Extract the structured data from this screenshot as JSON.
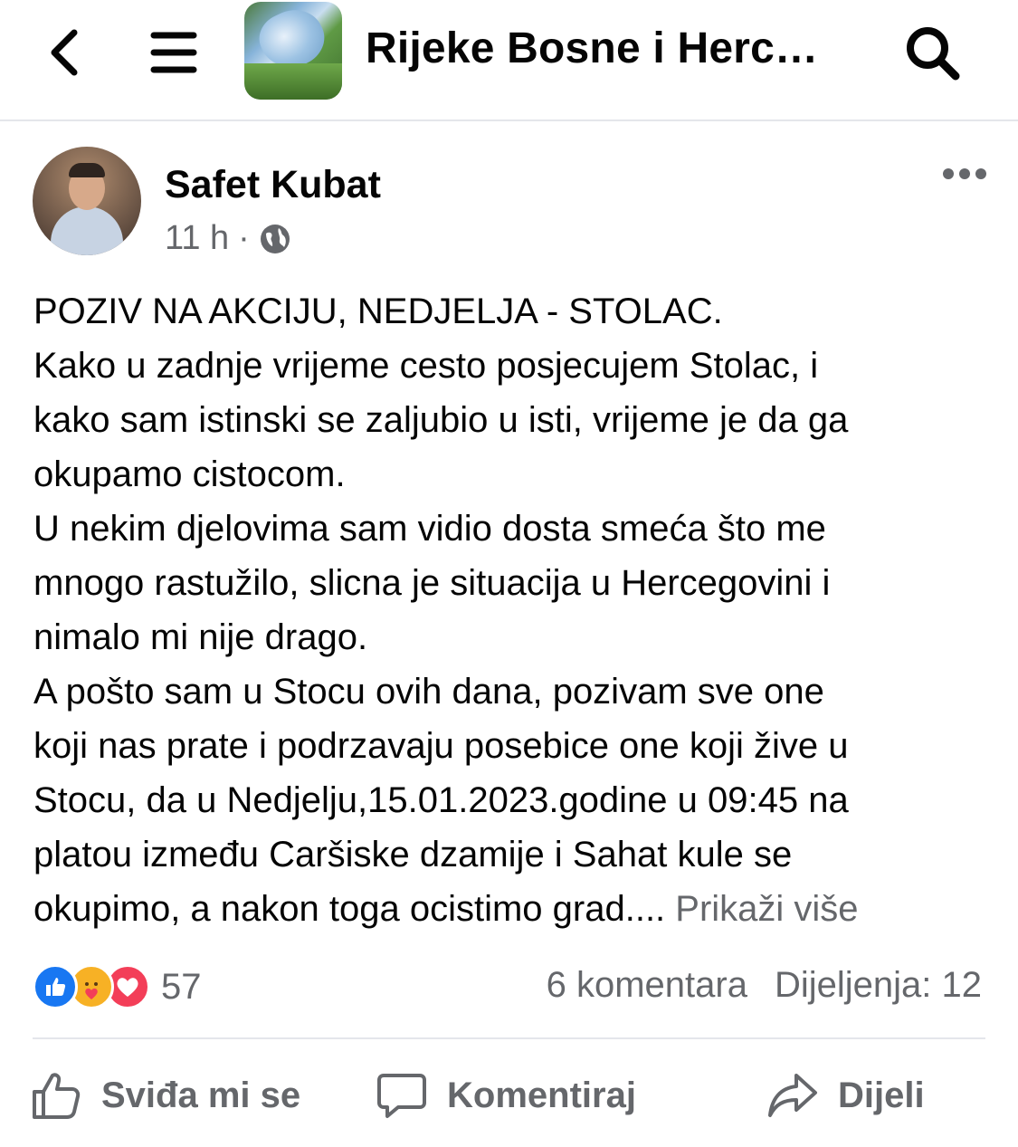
{
  "header": {
    "group_title": "Rijeke Bosne i Herc…"
  },
  "post": {
    "author": "Safet Kubat",
    "time": "11 h",
    "separator": "·",
    "body_lines": [
      "POZIV NA AKCIJU, NEDJELJA - STOLAC.",
      "Kako u zadnje vrijeme cesto posjecujem Stolac, i",
      "kako sam istinski se zaljubio u isti, vrijeme je da ga",
      "okupamo cistocom.",
      "U nekim djelovima sam vidio dosta smeća što me",
      "mnogo rastužilo, slicna je situacija u Hercegovini i",
      "nimalo mi nije drago.",
      "A pošto sam u Stocu ovih dana, pozivam sve one",
      "koji nas prate i podrzavaju posebice one koji žive u",
      "Stocu, da u Nedjelju,15.01.2023.godine u 09:45 na",
      "platou između Caršiske  dzamije i Sahat kule se"
    ],
    "last_line": "okupimo, a nakon toga ocistimo grad.... ",
    "see_more": "Prikaži više"
  },
  "stats": {
    "reaction_count": "57",
    "comments": "6 komentara",
    "shares": "Dijeljenja: 12"
  },
  "actions": {
    "like": "Sviđa mi se",
    "comment": "Komentiraj",
    "share": "Dijeli"
  },
  "colors": {
    "text": "#050505",
    "secondary": "#65676b",
    "like_blue": "#1877f2",
    "love_red": "#f33e58",
    "care_yellow": "#f7b125",
    "divider": "#e4e6eb"
  },
  "icons": {
    "back": "back-arrow-icon",
    "menu": "hamburger-menu-icon",
    "search": "search-icon",
    "more": "more-options-icon",
    "privacy": "globe-icon",
    "like": "thumbs-up-icon",
    "comment": "comment-bubble-icon",
    "share": "share-arrow-icon"
  }
}
